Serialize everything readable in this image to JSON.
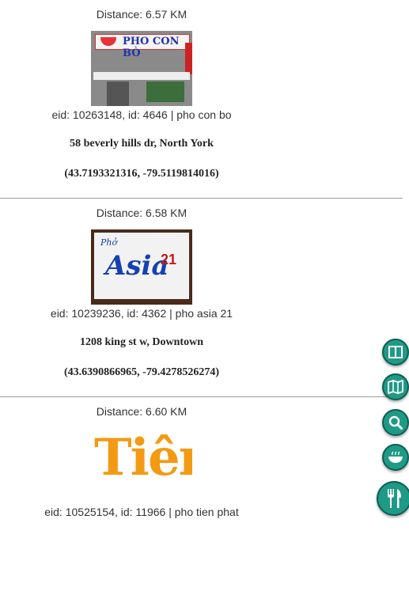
{
  "entries": [
    {
      "distance": "Distance: 6.57 KM",
      "image_alt": "pho con bo storefront",
      "image_text": "PHO CON BÒ",
      "ids": "eid: 10263148, id: 4646 | pho con bo",
      "address": "58 beverly hills dr, North York",
      "coords": "(43.7193321316, -79.5119814016)"
    },
    {
      "distance": "Distance: 6.58 KM",
      "image_alt": "pho asia 21 sign",
      "image_text_small": "Phở",
      "image_text": "Asia",
      "image_num": "21",
      "ids": "eid: 10239236, id: 4362 | pho asia 21",
      "address": "1208 king st w, Downtown",
      "coords": "(43.6390866965, -79.4278526274)"
    },
    {
      "distance": "Distance: 6.60 KM",
      "image_alt": "tien logo",
      "image_text": "Tiên",
      "ids": "eid: 10525154, id: 11966 | pho tien phat"
    }
  ],
  "fab": {
    "color": "#1f9a86",
    "buttons": [
      "split-view-icon",
      "map-icon",
      "search-icon",
      "bowl-icon",
      "utensils-icon"
    ]
  }
}
